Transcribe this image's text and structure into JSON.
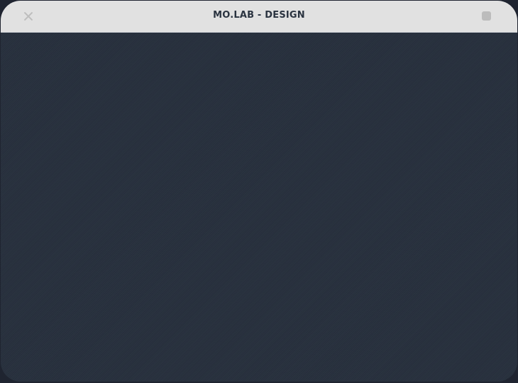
{
  "window": {
    "title": "MO.LAB - DESIGN"
  },
  "icons": {
    "close": "close-icon",
    "square": "square-icon"
  },
  "colors": {
    "titlebar": "#e1e1e1",
    "title_text": "#2a3340",
    "content_background": "#27303d",
    "controls": "#bcbcbc"
  }
}
